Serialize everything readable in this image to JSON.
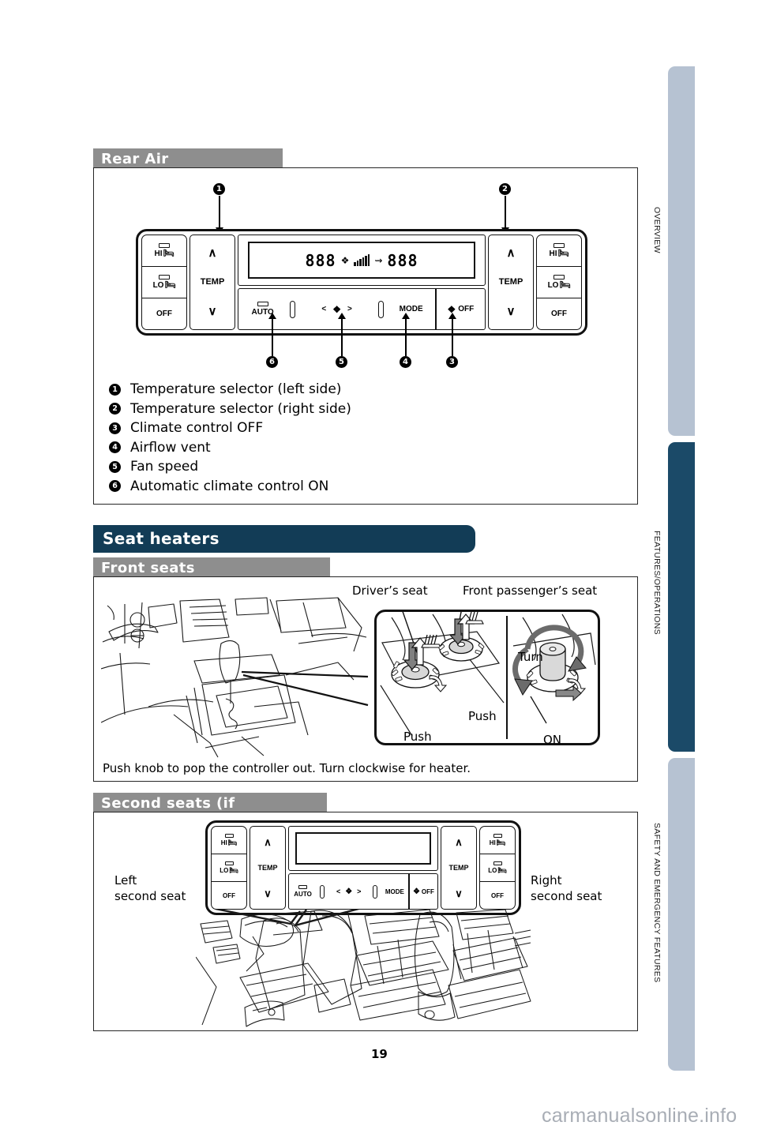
{
  "page": {
    "number": "19",
    "watermark": "carmanualsonline.info"
  },
  "sidebar": {
    "tabs": [
      {
        "label": "OVERVIEW",
        "color": "#b6c2d2",
        "active": false
      },
      {
        "label": "FEATURES/OPERATIONS",
        "color": "#1b4a68",
        "active": true
      },
      {
        "label": "SAFETY AND EMERGENCY FEATURES",
        "color": "#b6c2d2",
        "active": false
      }
    ]
  },
  "sections": {
    "rear_ac": {
      "title": "Rear Air Conditioning",
      "header_color": "#8e8e8e",
      "legend": [
        {
          "num": "1",
          "text": "Temperature selector (left side)"
        },
        {
          "num": "2",
          "text": "Temperature selector (right side)"
        },
        {
          "num": "3",
          "text": "Climate control OFF"
        },
        {
          "num": "4",
          "text": "Airflow vent"
        },
        {
          "num": "5",
          "text": "Fan speed"
        },
        {
          "num": "6",
          "text": "Automatic climate control ON"
        }
      ],
      "callouts": [
        {
          "num": "1"
        },
        {
          "num": "2"
        },
        {
          "num": "3"
        },
        {
          "num": "4"
        },
        {
          "num": "5"
        },
        {
          "num": "6"
        }
      ]
    },
    "seat_heaters": {
      "title": "Seat heaters",
      "header_color": "#123c56"
    },
    "front_seats": {
      "title": "Front seats",
      "header_color": "#8e8e8e",
      "labels": {
        "driver": "Driver’s seat",
        "passenger": "Front passenger’s seat",
        "push_left": "Push",
        "push_right": "Push",
        "turn": "Turn",
        "on": "ON"
      },
      "note": "Push knob to pop the controller out. Turn clockwise for heater."
    },
    "second_seats": {
      "title": "Second seats (if equipped)",
      "header_color": "#8e8e8e",
      "labels": {
        "left_line1": "Left",
        "left_line2": "second seat",
        "right_line1": "Right",
        "right_line2": "second seat"
      }
    }
  },
  "ac_panel": {
    "seat_buttons": {
      "hi": "HI",
      "lo": "LO",
      "off": "OFF"
    },
    "temp_label": "TEMP",
    "chevron_up": "∧",
    "chevron_down": "∨",
    "lcd": {
      "left_digits": "888",
      "right_digits": "888"
    },
    "controls": {
      "auto": "AUTO",
      "prev": "<",
      "next": ">",
      "mode": "MODE",
      "fan_off": "OFF"
    }
  }
}
